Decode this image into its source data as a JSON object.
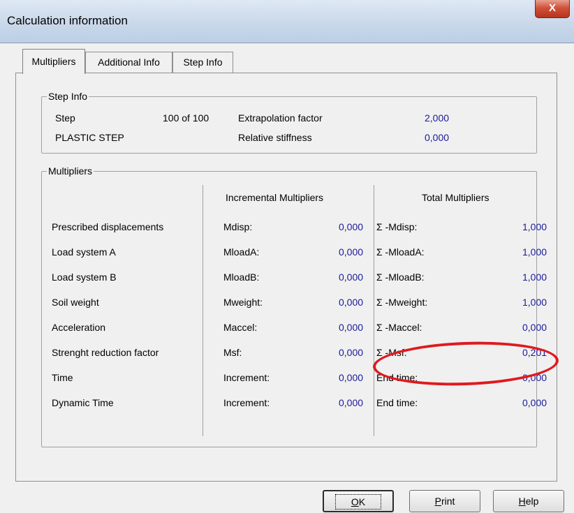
{
  "window": {
    "title": "Calculation information",
    "close_glyph": "X"
  },
  "tabs": [
    "Multipliers",
    "Additional Info",
    "Step Info"
  ],
  "step_info": {
    "group_label": "Step Info",
    "step_label": "Step",
    "step_value": "100 of 100",
    "phase_label": "PLASTIC STEP",
    "extrapolation_label": "Extrapolation factor",
    "extrapolation_value": "2,000",
    "stiffness_label": "Relative stiffness",
    "stiffness_value": "0,000"
  },
  "multipliers": {
    "group_label": "Multipliers",
    "incremental_header": "Incremental Multipliers",
    "total_header": "Total Multipliers",
    "rows": [
      {
        "name": "Prescribed displacements",
        "inc_label": "Mdisp:",
        "inc_value": "0,000",
        "tot_label": "Σ -Mdisp:",
        "tot_value": "1,000"
      },
      {
        "name": "Load system A",
        "inc_label": "MloadA:",
        "inc_value": "0,000",
        "tot_label": "Σ -MloadA:",
        "tot_value": "1,000"
      },
      {
        "name": "Load system B",
        "inc_label": "MloadB:",
        "inc_value": "0,000",
        "tot_label": "Σ -MloadB:",
        "tot_value": "1,000"
      },
      {
        "name": "Soil weight",
        "inc_label": "Mweight:",
        "inc_value": "0,000",
        "tot_label": "Σ -Mweight:",
        "tot_value": "1,000"
      },
      {
        "name": "Acceleration",
        "inc_label": "Maccel:",
        "inc_value": "0,000",
        "tot_label": "Σ -Maccel:",
        "tot_value": "0,000"
      },
      {
        "name": "Strenght reduction factor",
        "inc_label": "Msf:",
        "inc_value": "0,000",
        "tot_label": "Σ -Msf:",
        "tot_value": "0,201"
      },
      {
        "name": "Time",
        "inc_label": "Increment:",
        "inc_value": "0,000",
        "tot_label": "End time:",
        "tot_value": "0,000"
      },
      {
        "name": "Dynamic Time",
        "inc_label": "Increment:",
        "inc_value": "0,000",
        "tot_label": "End time:",
        "tot_value": "0,000"
      }
    ]
  },
  "buttons": {
    "ok_label": "OK",
    "ok_mnemonic": "O",
    "ok_rest": "K",
    "print_mnemonic": "P",
    "print_rest": "rint",
    "help_mnemonic": "H",
    "help_rest": "elp"
  },
  "highlight_color": "#e0191f"
}
